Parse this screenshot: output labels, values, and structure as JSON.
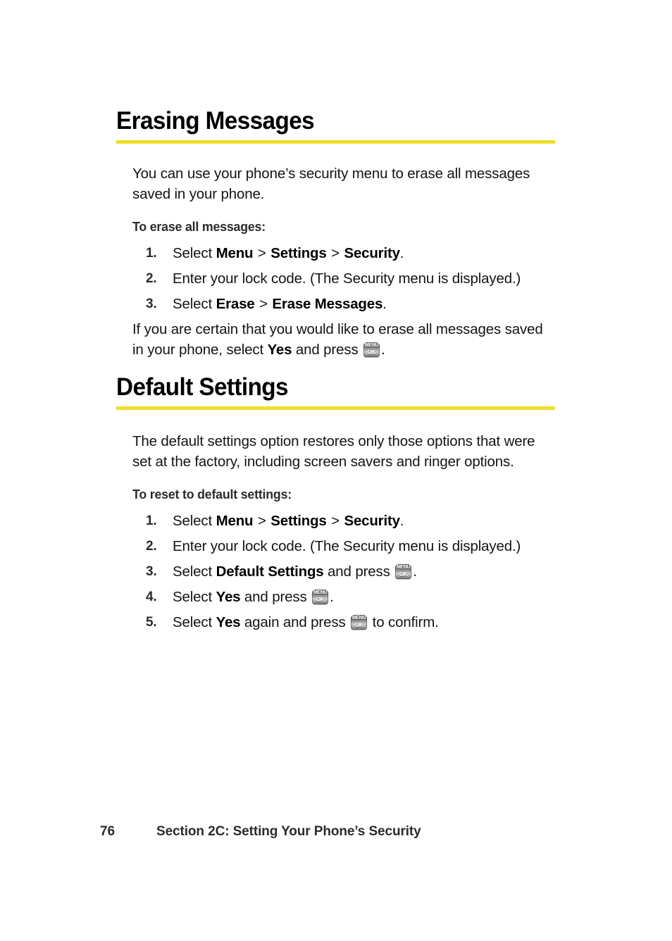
{
  "page": {
    "background": "#ffffff",
    "rule_color": "#EDE02B"
  },
  "sections": [
    {
      "heading": "Erasing Messages",
      "intro": "You can use your phone’s security menu to erase all messages saved in your phone.",
      "subhead": "To erase all messages:",
      "steps": [
        {
          "num": "1.",
          "pre": "Select ",
          "b1": "Menu",
          "sep1": " > ",
          "b2": "Settings",
          "sep2": " > ",
          "b3": "Security",
          "post": "."
        },
        {
          "num": "2.",
          "pre": "Enter your lock code. (The Security menu is displayed.)",
          "b1": "",
          "sep1": "",
          "b2": "",
          "sep2": "",
          "b3": "",
          "post": ""
        },
        {
          "num": "3.",
          "pre": "Select ",
          "b1": "Erase",
          "sep1": " > ",
          "b2": "Erase Messages",
          "sep2": "",
          "b3": "",
          "post": "."
        }
      ],
      "follow_pre": "If you are certain that you would like to erase all messages saved in your phone, select ",
      "follow_bold": "Yes",
      "follow_mid": " and press ",
      "follow_post": "."
    },
    {
      "heading": "Default Settings",
      "intro": "The default settings option restores only those options that were set at the factory, including screen savers and ringer options.",
      "subhead": "To reset to default settings:",
      "steps": [
        {
          "num": "1.",
          "pre": "Select ",
          "b1": "Menu",
          "sep1": " > ",
          "b2": "Settings",
          "sep2": " > ",
          "b3": "Security",
          "post": "."
        },
        {
          "num": "2.",
          "pre": "Enter your lock code. (The Security menu is displayed.)",
          "b1": "",
          "sep1": "",
          "b2": "",
          "sep2": "",
          "b3": "",
          "post": ""
        },
        {
          "num": "3.",
          "pre": "Select ",
          "b1": "Default Settings",
          "mid": " and press ",
          "post": "."
        },
        {
          "num": "4.",
          "pre": "Select ",
          "b1": "Yes",
          "mid": " and press ",
          "post": "."
        },
        {
          "num": "5.",
          "pre": "Select ",
          "b1": "Yes",
          "mid": " again and press ",
          "post": " to confirm."
        }
      ]
    }
  ],
  "key_icon": {
    "line1": "MENU",
    "line2": "OK",
    "name": "menu-ok-key-icon"
  },
  "footer": {
    "page_number": "76",
    "section_text": "Section 2C: Setting Your Phone’s Security"
  }
}
